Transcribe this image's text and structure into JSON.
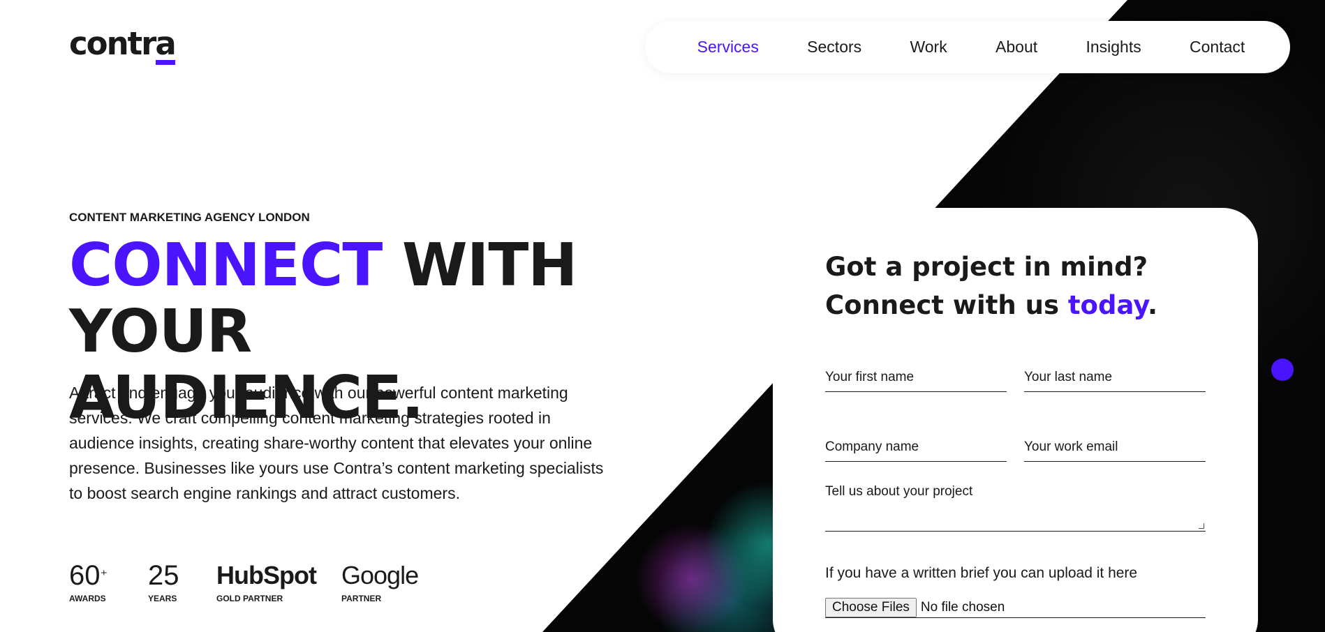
{
  "brand": {
    "logo_text": "contra",
    "accent_color": "#4b14ff"
  },
  "nav": {
    "items": [
      {
        "label": "Services",
        "active": true
      },
      {
        "label": "Sectors"
      },
      {
        "label": "Work"
      },
      {
        "label": "About"
      },
      {
        "label": "Insights"
      },
      {
        "label": "Contact"
      }
    ]
  },
  "hero": {
    "eyebrow": "CONTENT MARKETING AGENCY LONDON",
    "headline_highlight": "CONNECT",
    "headline_rest_line1": " WITH YOUR",
    "headline_line2": "AUDIENCE.",
    "intro": "Attract and engage your audience with our powerful content marketing services. We craft compelling content marketing strategies rooted in audience insights, creating share-worthy content that elevates your online presence. Businesses like yours use Contra’s content marketing specialists to boost search engine rankings and attract customers."
  },
  "stats": [
    {
      "value": "60",
      "suffix": "⁺",
      "label": "AWARDS"
    },
    {
      "value": "25",
      "label": "YEARS"
    },
    {
      "value": "HubSpot",
      "label": "GOLD PARTNER"
    },
    {
      "value": "Google",
      "label": "PARTNER"
    }
  ],
  "form": {
    "title_line1": "Got a project in mind?",
    "title_line2_prefix": "Connect with us ",
    "title_line2_highlight": "today",
    "title_line2_suffix": ".",
    "first_name_placeholder": "Your first name",
    "last_name_placeholder": "Your last name",
    "company_placeholder": "Company name",
    "email_placeholder": "Your work email",
    "project_placeholder": "Tell us about your project",
    "upload_label": "If you have a written brief you can upload it here",
    "upload_button": "Choose Files",
    "upload_status": "No file chosen"
  }
}
